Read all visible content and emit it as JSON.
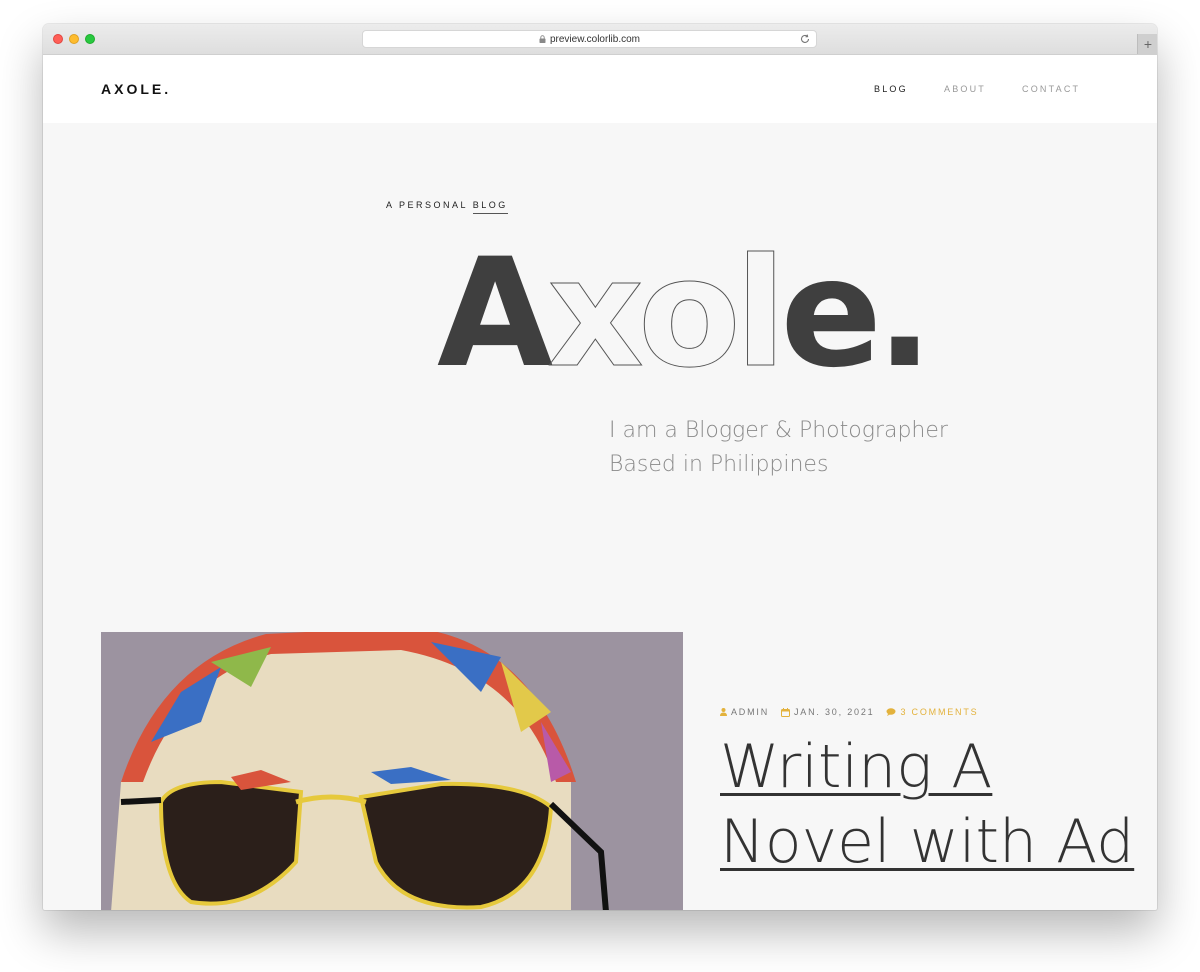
{
  "browser": {
    "url": "preview.colorlib.com"
  },
  "site": {
    "logo": "AXOLE.",
    "nav": [
      {
        "label": "BLOG",
        "active": true
      },
      {
        "label": "ABOUT",
        "active": false
      },
      {
        "label": "CONTACT",
        "active": false
      }
    ]
  },
  "hero": {
    "eyebrow_prefix": "A PERSONAL ",
    "eyebrow_underlined": "BLOG",
    "title": "Axole.",
    "tagline_line1": "I am a Blogger & Photographer",
    "tagline_line2": "Based in Philippines"
  },
  "post": {
    "author": "ADMIN",
    "date": "JAN. 30, 2021",
    "comments": "3 COMMENTS",
    "title": "Writing A Novel with Ad"
  },
  "colors": {
    "accent": "#e3b23c",
    "hero_fill": "#3f3f3f",
    "background": "#f7f7f7"
  }
}
